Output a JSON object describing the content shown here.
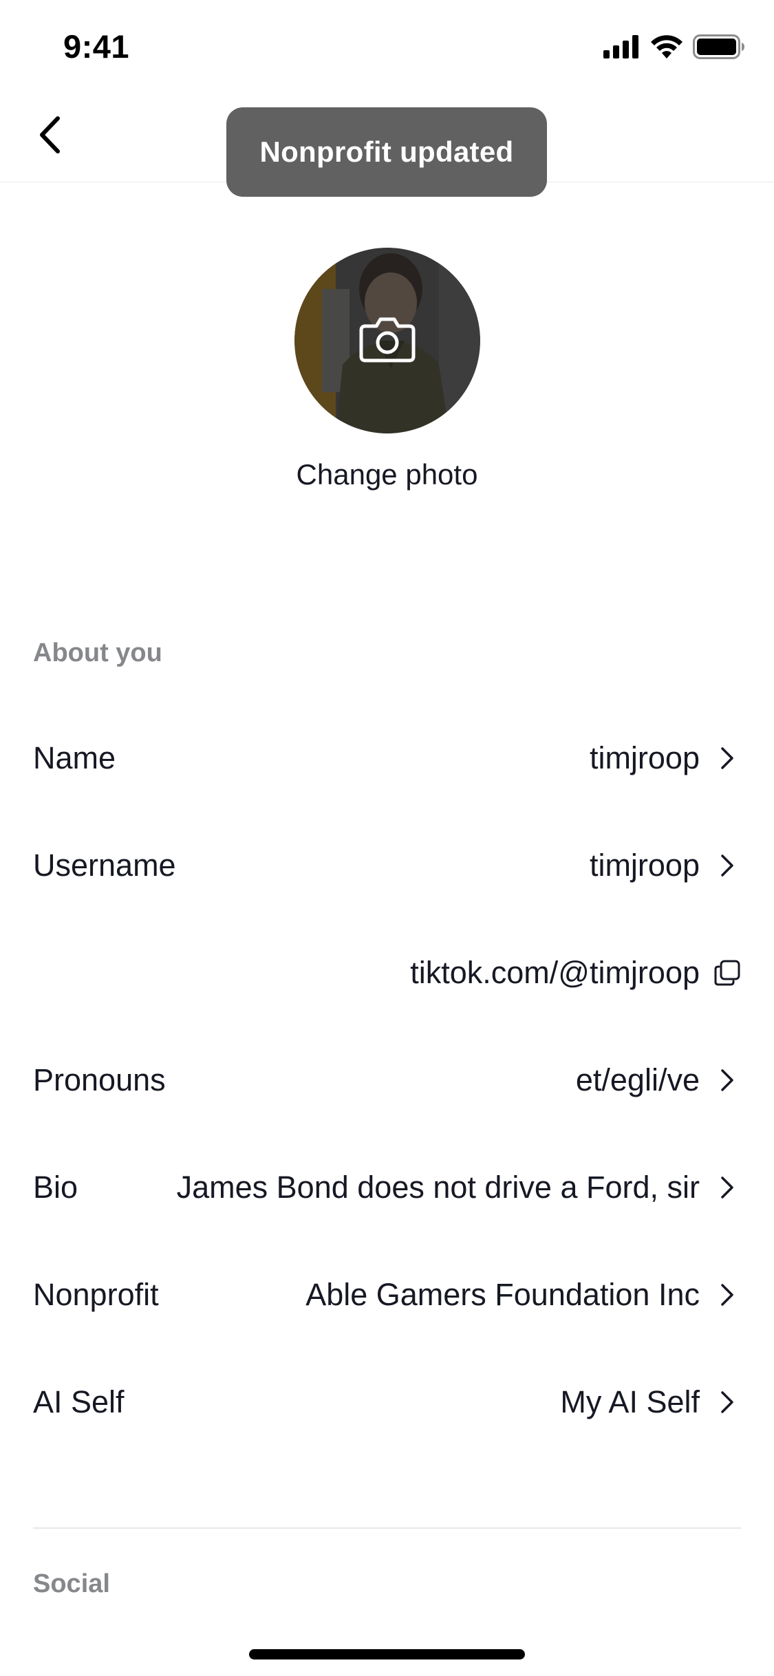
{
  "status_bar": {
    "time": "9:41"
  },
  "toast": {
    "message": "Nonprofit updated"
  },
  "profile": {
    "change_photo_label": "Change photo"
  },
  "sections": {
    "about_you": "About you",
    "social": "Social"
  },
  "rows": {
    "name": {
      "label": "Name",
      "value": "timjroop"
    },
    "username": {
      "label": "Username",
      "value": "timjroop"
    },
    "profile_link": {
      "value": "tiktok.com/@timjroop"
    },
    "pronouns": {
      "label": "Pronouns",
      "value": "et/egli/ve"
    },
    "bio": {
      "label": "Bio",
      "value": "James Bond does not drive a Ford, sir"
    },
    "nonprofit": {
      "label": "Nonprofit",
      "value": "Able Gamers Foundation Inc"
    },
    "ai_self": {
      "label": "AI Self",
      "value": "My AI Self"
    }
  },
  "icons": {
    "back": "chevron-left-icon",
    "row_arrow": "chevron-right-icon",
    "copy": "copy-icon",
    "camera": "camera-icon",
    "signal": "cellular-signal-icon",
    "wifi": "wifi-icon",
    "battery": "battery-icon"
  },
  "colors": {
    "text_primary": "#161823",
    "text_secondary": "#86878b",
    "toast_bg": "#545454",
    "divider": "#e8e8ea"
  }
}
